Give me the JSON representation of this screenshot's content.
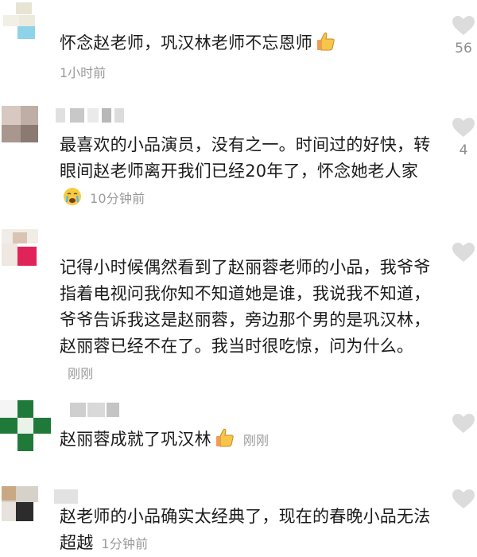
{
  "comments": [
    {
      "text": "怀念赵老师，巩汉林老师不忘恩师",
      "emoji": "thumbs-up-icon",
      "time": "1小时前",
      "likes": "56"
    },
    {
      "text": "最喜欢的小品演员，没有之一。时间过的好快，转眼间赵老师离开我们已经20年了，怀念她老人家",
      "emoji": "crying-face-icon",
      "time": "10分钟前",
      "likes": "4"
    },
    {
      "text": "记得小时候偶然看到了赵丽蓉老师的小品，我爷爷指着电视问我你知不知道她是谁，我说我不知道，爷爷告诉我这是赵丽蓉，旁边那个男的是巩汉林，赵丽蓉已经不在了。我当时很吃惊，问为什么。",
      "time": "刚刚",
      "likes": ""
    },
    {
      "text": "赵丽蓉成就了巩汉林",
      "emoji": "thumbs-up-icon",
      "time": "刚刚",
      "likes": ""
    },
    {
      "text": "赵老师的小品确实太经典了，现在的春晚小品无法超越",
      "time": "1分钟前",
      "likes": ""
    }
  ],
  "colors": {
    "heart": "#dcdcdc",
    "time": "#9a9a9a",
    "text": "#1b1b1b"
  }
}
